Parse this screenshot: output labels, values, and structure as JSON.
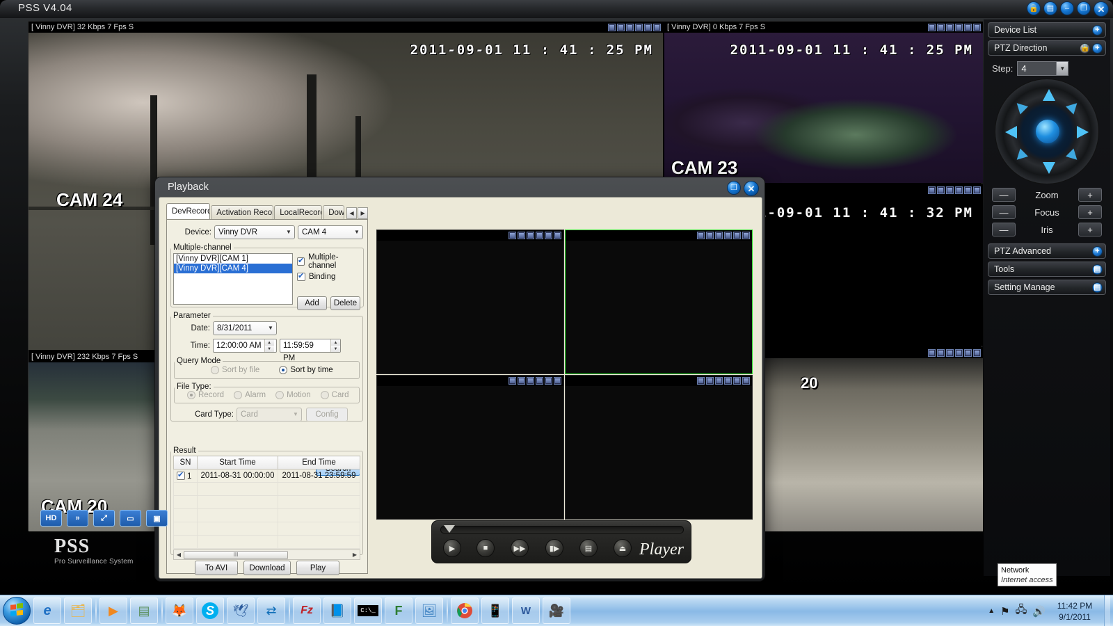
{
  "app": {
    "title": "PSS  V4.04",
    "window_buttons": [
      "lock-icon",
      "list-icon",
      "minimize-icon",
      "restore-icon",
      "close-icon"
    ]
  },
  "video_wall": {
    "cells": [
      {
        "header": "[ Vinny DVR] 32 Kbps 7 Fps S",
        "timestamp": "2011-09-01  11 : 41 : 25  PM",
        "label": "CAM 24",
        "selected": true,
        "scene": "street"
      },
      {
        "header": "[ Vinny DVR] 0 Kbps 7 Fps S",
        "timestamp": "2011-09-01  11 : 41 : 25  PM",
        "label": "CAM 23",
        "selected": false,
        "scene": "dark"
      },
      {
        "header": "",
        "timestamp": "2011-09-01  11 : 41 : 32  PM",
        "label": "",
        "selected": false,
        "scene": "blank"
      },
      {
        "header": "[ Vinny DVR] 232 Kbps 7 Fps S",
        "timestamp": "",
        "label": "CAM 20",
        "selected": false,
        "scene": "lot"
      },
      {
        "header": "",
        "timestamp": "",
        "label": "20",
        "selected": false,
        "scene": "store"
      }
    ],
    "cell_toolbar": [
      "HD",
      "»",
      "⤢",
      "▭",
      "▣"
    ]
  },
  "logo": {
    "name": "PSS",
    "subtitle": "Pro Surveillance System"
  },
  "right_panel": {
    "device_list": "Device List",
    "ptz_direction": "PTZ Direction",
    "step_label": "Step:",
    "step_value": "4",
    "ptz_controls": [
      {
        "label": "Zoom",
        "minus": "—",
        "plus": "+"
      },
      {
        "label": "Focus",
        "minus": "—",
        "plus": "+"
      },
      {
        "label": "Iris",
        "minus": "—",
        "plus": "+"
      }
    ],
    "ptz_advanced": "PTZ Advanced",
    "tools": "Tools",
    "setting_manage": "Setting Manage"
  },
  "playback": {
    "title": "Playback",
    "window_buttons": [
      "restore-icon",
      "close-icon"
    ],
    "tabs": [
      {
        "label": "DevRecord",
        "active": true
      },
      {
        "label": "Activation Record",
        "active": false
      },
      {
        "label": "LocalRecord",
        "active": false
      },
      {
        "label": "Downl",
        "active": false
      }
    ],
    "tab_nav": [
      "◀",
      "▶"
    ],
    "device_label": "Device:",
    "device_value": "Vinny DVR",
    "channel_value": "CAM 4",
    "multichannel_legend": "Multiple-channel",
    "channel_list": [
      {
        "text": "[Vinny DVR][CAM 1]",
        "selected": false
      },
      {
        "text": "[Vinny DVR][CAM 4]",
        "selected": true
      }
    ],
    "checkboxes": [
      {
        "label": "Multiple-channel",
        "checked": true
      },
      {
        "label": "Binding",
        "checked": true
      }
    ],
    "add_button": "Add",
    "delete_button": "Delete",
    "parameter_legend": "Parameter",
    "date_label": "Date:",
    "date_value": "8/31/2011",
    "time_label": "Time:",
    "time_start": "12:00:00 AM",
    "time_end": "11:59:59 PM",
    "query_mode_legend": "Query Mode",
    "query_modes": [
      {
        "label": "Sort by file",
        "checked": false,
        "disabled": true
      },
      {
        "label": "Sort by time",
        "checked": true,
        "disabled": false
      }
    ],
    "file_type_legend": "File Type:",
    "file_types": [
      {
        "label": "Record",
        "checked": true,
        "disabled": true
      },
      {
        "label": "Alarm",
        "checked": false,
        "disabled": true
      },
      {
        "label": "Motion",
        "checked": false,
        "disabled": true
      },
      {
        "label": "Card",
        "checked": false,
        "disabled": true
      }
    ],
    "card_type_label": "Card Type:",
    "card_type_value": "Card",
    "config_button": "Config",
    "search_button": "Search",
    "result_legend": "Result",
    "result_columns": [
      "SN",
      "Start Time",
      "End Time"
    ],
    "result_rows": [
      {
        "checked": true,
        "sn": "1",
        "start": "2011-08-31 00:00:00",
        "end": "2011-08-31 23:59:59"
      }
    ],
    "result_empty_rows": 6,
    "bottom_buttons": [
      "To AVI",
      "Download",
      "Play"
    ],
    "preview_cells": [
      {
        "selected": false
      },
      {
        "selected": true
      },
      {
        "selected": false
      },
      {
        "selected": false
      }
    ],
    "player": {
      "buttons": [
        "play-icon",
        "stop-icon",
        "fast-forward-icon",
        "step-frame-icon",
        "list-icon",
        "eject-icon"
      ],
      "brand": "Player"
    }
  },
  "taskbar": {
    "start": "start-orb-icon",
    "items": [
      "internet-explorer-icon",
      "file-explorer-icon",
      "windows-media-player-icon",
      "app-window-icon",
      "firefox-icon",
      "skype-icon",
      "thunderbird-icon",
      "teamviewer-icon",
      "filezilla-icon",
      "notepad-icon",
      "command-prompt-icon",
      "foxit-icon",
      "photo-viewer-icon",
      "chrome-icon",
      "mobile-mail-icon",
      "word-icon",
      "webcam-icon"
    ],
    "tray": [
      "show-hidden-icons",
      "flag-action-center-icon",
      "network-icon",
      "volume-icon"
    ],
    "clock_time": "11:42 PM",
    "clock_date": "9/1/2011"
  },
  "tooltip": {
    "title": "Network",
    "detail": "Internet access"
  }
}
